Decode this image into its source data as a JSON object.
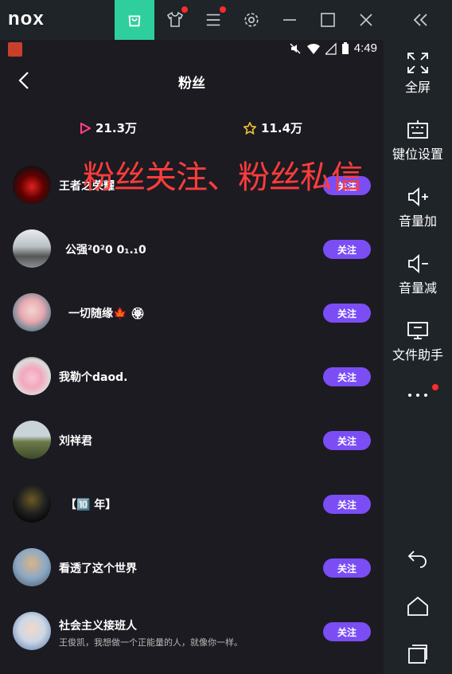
{
  "emulator": {
    "logo_text": "nox",
    "sidebar": [
      {
        "label": "全屏",
        "icon": "fullscreen-icon"
      },
      {
        "label": "键位设置",
        "icon": "keyboard-icon"
      },
      {
        "label": "音量加",
        "icon": "volume-up-icon"
      },
      {
        "label": "音量减",
        "icon": "volume-down-icon"
      },
      {
        "label": "文件助手",
        "icon": "monitor-icon"
      }
    ],
    "accent": "#2ecf9c"
  },
  "status": {
    "time": "4:49"
  },
  "page": {
    "title": "粉丝",
    "stats": {
      "plays": "21.3万",
      "likes": "11.4万"
    },
    "overlay_text": "粉丝关注、粉丝私信",
    "follow_label": "关注",
    "follow_color": "#7b4df5",
    "users": [
      {
        "name": "王者之荣耀",
        "sub": ""
      },
      {
        "name": "公强²0²0 0₁.₁0",
        "sub": ""
      },
      {
        "name": "一切随缘🍁 🏵",
        "sub": ""
      },
      {
        "name": "我勒个daod.",
        "sub": ""
      },
      {
        "name": "刘祥君",
        "sub": ""
      },
      {
        "name": "【🔟 年】",
        "sub": ""
      },
      {
        "name": "看透了这个世界",
        "sub": ""
      },
      {
        "name": "社会主义接班人",
        "sub": "王俊凯，我想做一个正能量的人，就像你一样。"
      }
    ]
  }
}
